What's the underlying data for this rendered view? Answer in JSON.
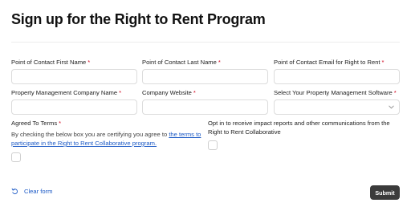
{
  "page": {
    "title": "Sign up for the Right to Rent Program"
  },
  "form": {
    "required_marker": "*",
    "fields": [
      {
        "label": "Point of Contact First Name",
        "value": ""
      },
      {
        "label": "Point of Contact Last Name",
        "value": ""
      },
      {
        "label": "Point of Contact Email for Right to Rent",
        "value": ""
      },
      {
        "label": "Property Management Company Name",
        "value": ""
      },
      {
        "label": "Company Website",
        "value": ""
      },
      {
        "label": "Select Your Property Management Software",
        "value": ""
      }
    ],
    "terms": {
      "label": "Agreed To Terms",
      "description": "By checking the below box you are certifying you agree to",
      "link_text": "the terms to participate in the Right to Rent Collaborative program.",
      "checked": false
    },
    "opt_in": {
      "label": "Opt in to receive impact reports and other communications from the Right to Rent Collaborative",
      "checked": false
    },
    "actions": {
      "clear_label": "Clear form",
      "submit_label": "Submit"
    }
  },
  "colors": {
    "link": "#1e5bc6",
    "required": "#d0021b",
    "submit_bg": "#3b3b3b"
  },
  "icons": {
    "clear": "reset-icon",
    "select": "chevron-down-icon"
  }
}
